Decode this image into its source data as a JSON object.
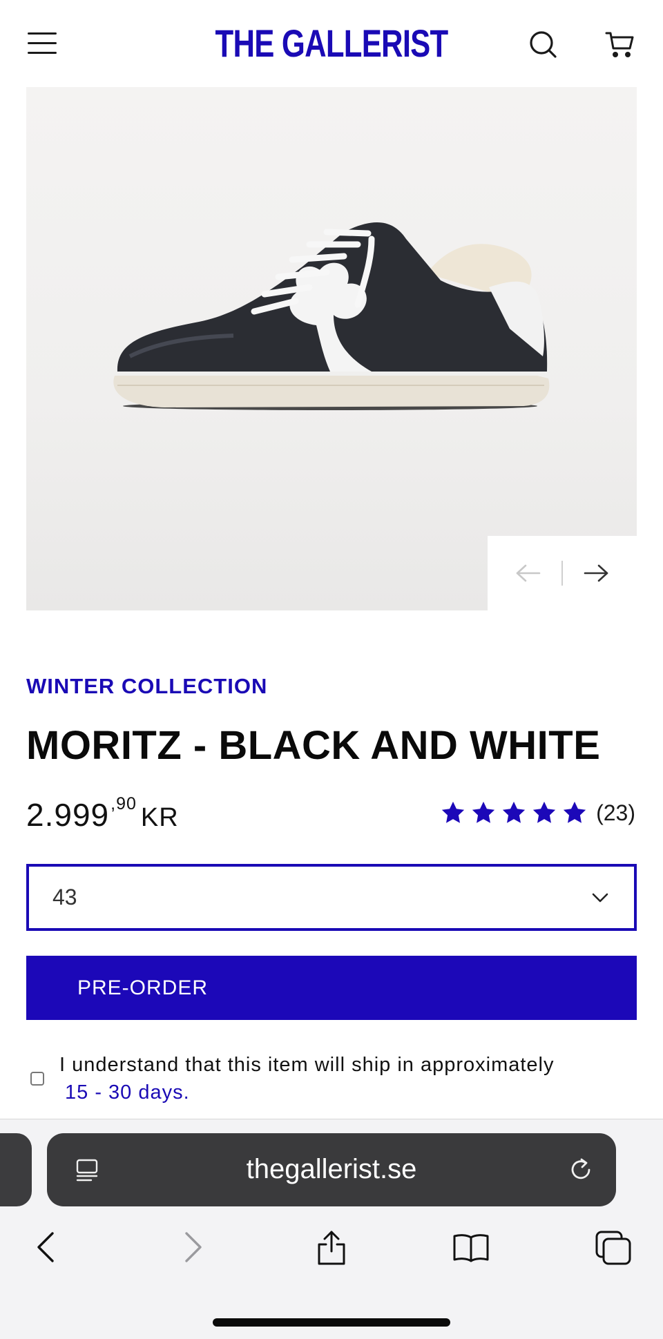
{
  "header": {
    "brand": "THE GALLERIST",
    "brand_color": "#1a0ab5",
    "menu_icon": "hamburger-icon",
    "search_icon": "search-icon",
    "cart_icon": "cart-icon"
  },
  "gallery": {
    "prev_icon": "arrow-left-icon",
    "next_icon": "arrow-right-icon"
  },
  "product": {
    "collection": "WINTER COLLECTION",
    "title": "MORITZ - BLACK AND WHITE",
    "price_main": "2.999",
    "price_decimals": ",90",
    "currency": "KR",
    "rating_stars": 5,
    "rating_count": "(23)",
    "size_selected": "43",
    "preorder_label": "PRE-ORDER",
    "consent_text": "I understand that this item will ship in approximately",
    "consent_days": "15 - 30 days."
  },
  "browser": {
    "url": "thegallerist.se",
    "reader_icon": "reader-icon",
    "reload_icon": "reload-icon",
    "toolbar": [
      "back-icon",
      "forward-icon",
      "share-icon",
      "bookmarks-icon",
      "tabs-icon"
    ]
  },
  "colors": {
    "accent": "#1c08b8",
    "text": "#0d0d0d"
  }
}
